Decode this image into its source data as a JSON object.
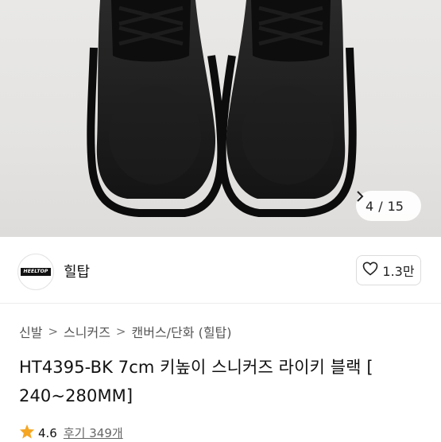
{
  "gallery": {
    "image_alt": "black sneakers product photo",
    "counter_current": "4",
    "counter_sep": "/",
    "counter_total": "15",
    "next_icon": "chevron-right-icon"
  },
  "store": {
    "logo_text": "HEELTOP",
    "name": "힐탑",
    "follow_icon": "heart-outline-icon",
    "follow_count": "1.3만"
  },
  "breadcrumb": {
    "items": [
      "신발",
      "스니커즈",
      "캔버스/단화 (힐탑)"
    ],
    "separator": ">"
  },
  "product": {
    "title": "HT4395-BK 7cm 키높이 스니커즈 라이키 블랙 [ 240~280MM]"
  },
  "rating": {
    "icon": "star-icon",
    "score": "4.6",
    "reviews": "후기 349개",
    "star_color": "#f5a623"
  }
}
